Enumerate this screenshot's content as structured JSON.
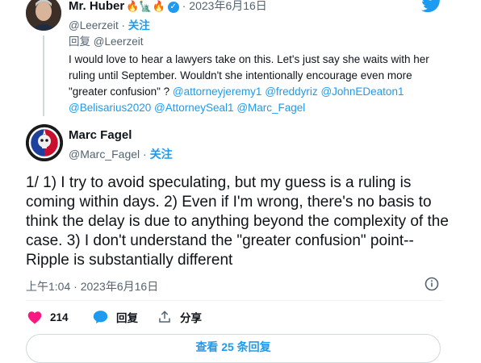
{
  "reply_tweet": {
    "author_name": "Mr. Huber",
    "author_emojis": "🔥🗽🔥",
    "date": "· 2023年6月16日",
    "handle": "@Leerzeit",
    "separator": " · ",
    "follow_label": "关注",
    "reply_to": "回复 @Leerzeit",
    "body_text": "I would love to hear a lawyers take on this. Let's just say she waits with her ruling until September. Wouldn't she intentionally encourage even more \"greater confusion\" ? ",
    "mentions": [
      "@attorneyjeremy1",
      "@freddyriz",
      "@JohnEDeaton1",
      "@Belisarius2020",
      "@AttorneySeal1",
      "@Marc_Fagel"
    ]
  },
  "main_tweet": {
    "author_name": "Marc Fagel",
    "handle": "@Marc_Fagel",
    "separator": " · ",
    "follow_label": "关注",
    "text": "1/ 1) I try to avoid speculating, but my guess is a ruling is coming within days. 2) Even if I'm wrong, there's no basis to think the delay is due to anything beyond the complexity of the case. 3) I don't understand the \"greater confusion\" point--Ripple is substantially different",
    "timestamp": "上午1:04 · 2023年6月16日"
  },
  "actions": {
    "like_count": "214",
    "reply_label": "回复",
    "share_label": "分享"
  },
  "view_replies_label": "查看 25 条回复",
  "colors": {
    "accent": "#1d9bf0",
    "like": "#f91880"
  },
  "icons": [
    "twitter-logo-icon",
    "verified-icon",
    "info-icon",
    "heart-icon",
    "reply-bubble-icon",
    "share-icon"
  ]
}
